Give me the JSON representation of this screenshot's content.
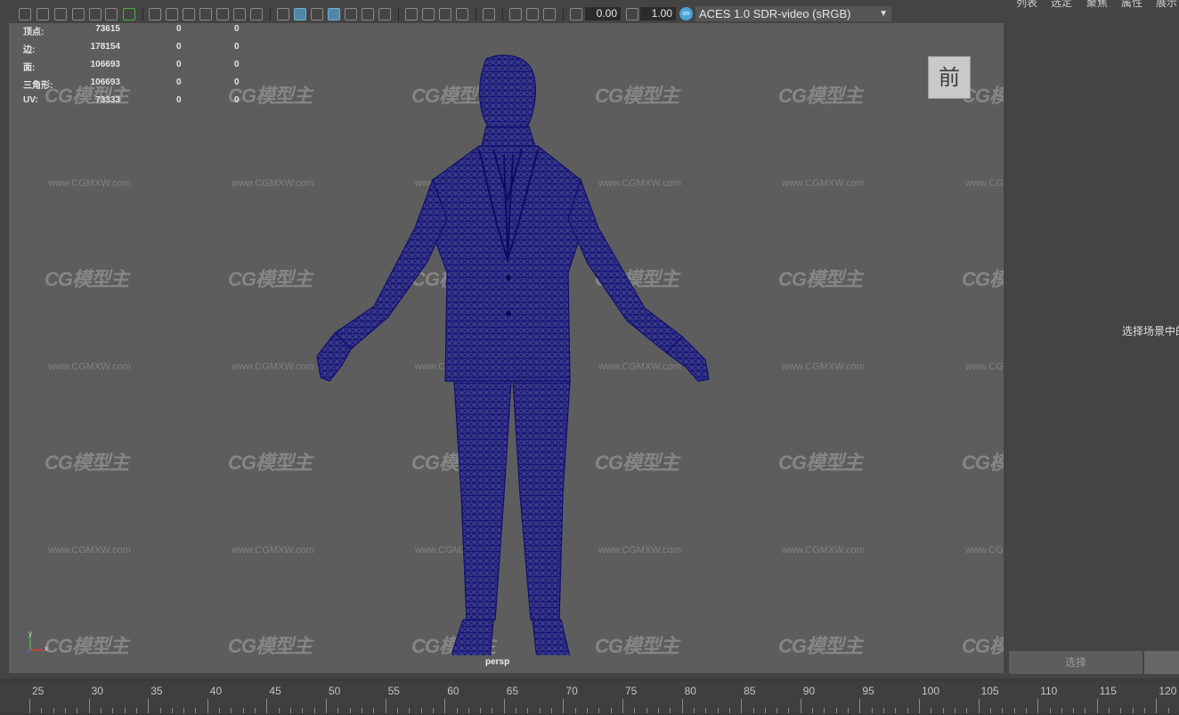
{
  "toolbar": {
    "exposure_value": "0.00",
    "gamma_value": "1.00",
    "color_management_icon": "on",
    "view_transform": "ACES 1.0 SDR-video (sRGB)"
  },
  "viewport": {
    "hud": {
      "rows": [
        {
          "label": "顶点:",
          "v1": "73615",
          "v2": "0",
          "v3": "0"
        },
        {
          "label": "边:",
          "v1": "178154",
          "v2": "0",
          "v3": "0"
        },
        {
          "label": "面:",
          "v1": "106693",
          "v2": "0",
          "v3": "0"
        },
        {
          "label": "三角形:",
          "v1": "106693",
          "v2": "0",
          "v3": "0"
        },
        {
          "label": "UV:",
          "v1": "73333",
          "v2": "0",
          "v3": "0"
        }
      ]
    },
    "viewcube_label": "前",
    "camera_label": "persp",
    "wireframe_color": "#1a1a8c",
    "watermark_logo": "CG模型主",
    "watermark_url": "www.CGMXW.com",
    "axis_labels": {
      "y": "y",
      "x": "x"
    }
  },
  "right_panel": {
    "tabs": [
      "列表",
      "选定",
      "聚焦",
      "属性",
      "展示"
    ],
    "hint_text": "选择场景中的",
    "select_button": "选择"
  },
  "timeline": {
    "ticks": [
      "25",
      "30",
      "35",
      "40",
      "45",
      "50",
      "55",
      "60",
      "65",
      "70",
      "75",
      "80",
      "85",
      "90",
      "95",
      "100",
      "105",
      "110",
      "115",
      "120"
    ]
  }
}
